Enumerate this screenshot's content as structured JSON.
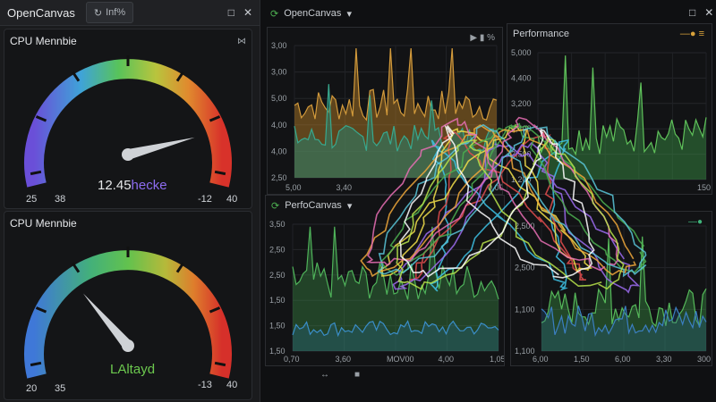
{
  "left_window": {
    "title": "OpenCanvas",
    "tab_label": "Inf%",
    "gauge1": {
      "label": "CPU Mennbie",
      "readout_num": "12.45",
      "readout_text": "hecke",
      "min_label": "25",
      "low_label": "38",
      "high_label": "-12",
      "max_label": "40",
      "needle_level": 0.78,
      "corner_icon": "collapse-icon"
    },
    "gauge2": {
      "label": "CPU Mennbie",
      "readout_text": "LAltayd",
      "min_label": "20",
      "low_label": "35",
      "high_label": "-13",
      "max_label": "40",
      "needle_level": 0.35
    }
  },
  "main_window": {
    "title": "OpenCanvas",
    "top_chart": {
      "y_ticks": [
        "3,00",
        "3,00",
        "5,00",
        "4,00",
        "4,00",
        "2,50"
      ],
      "x_ticks": [
        "5,00",
        "3,40",
        "",
        "",
        "0,00"
      ],
      "legend_text": "▶ ▮ %"
    },
    "perf_window": {
      "title": "Performance",
      "y_ticks": [
        "5,000",
        "4,400",
        "3,200",
        "2,400",
        "2,500",
        "1,200"
      ],
      "x_ticks": [
        "",
        "",
        "",
        "",
        "",
        "150"
      ]
    },
    "bottom_left": {
      "title": "PerfoCanvas",
      "y_ticks": [
        "3,50",
        "2,50",
        "2,50",
        "1,50",
        "1,50",
        "1,50"
      ],
      "x_ticks": [
        "0,70",
        "3,60",
        "MOV00",
        "4,00",
        "1,050"
      ]
    },
    "bottom_right": {
      "y_ticks": [
        "2,500",
        "2,500",
        "1,100",
        "1,100"
      ],
      "x_ticks": [
        "6,00",
        "1,50",
        "6,00",
        "3,30",
        "300"
      ]
    }
  }
}
